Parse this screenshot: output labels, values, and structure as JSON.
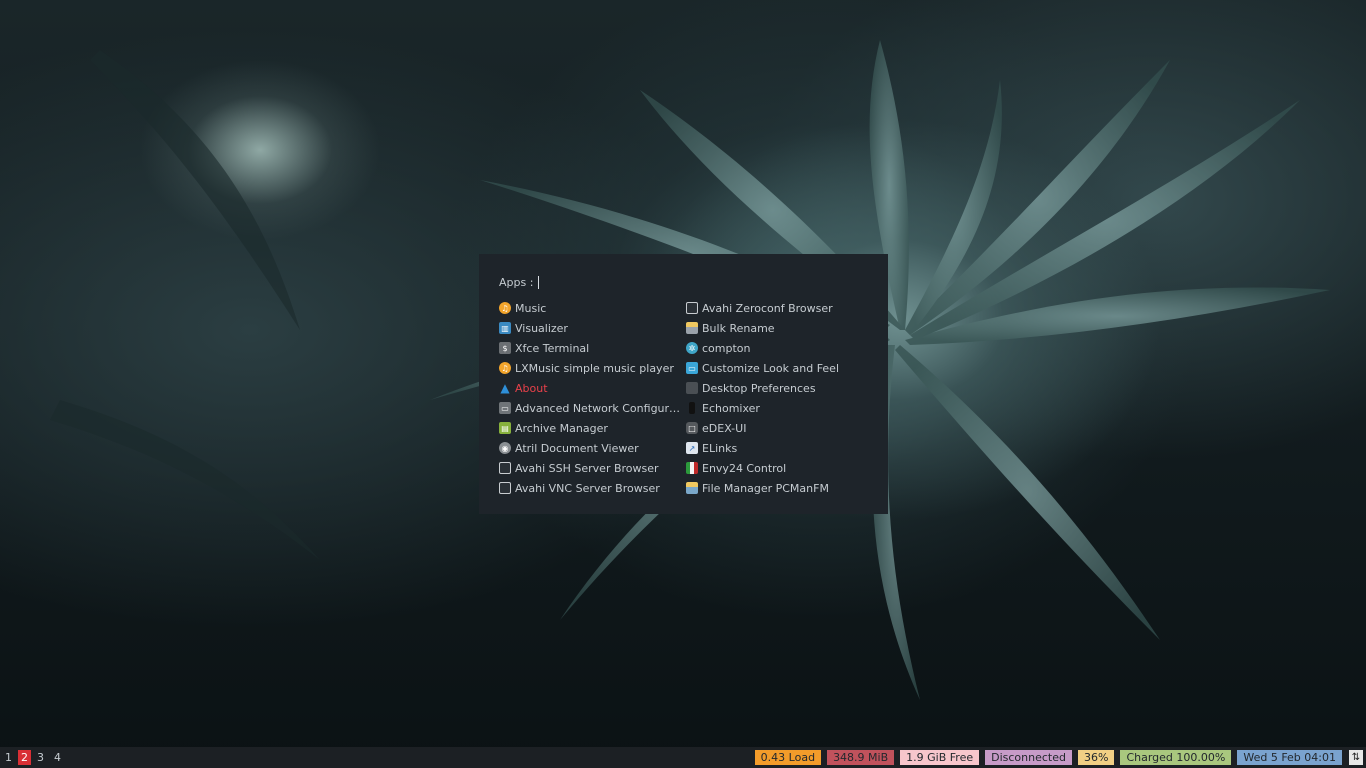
{
  "launcher": {
    "prompt": "Apps :",
    "left_items": [
      {
        "label": "Music",
        "icon": "music-icon"
      },
      {
        "label": "Visualizer",
        "icon": "visualizer-icon"
      },
      {
        "label": "Xfce Terminal",
        "icon": "terminal-icon"
      },
      {
        "label": "LXMusic simple music player",
        "icon": "music-icon"
      },
      {
        "label": "About",
        "icon": "about-icon",
        "selected": true
      },
      {
        "label": "Advanced Network Configurati...",
        "icon": "network-icon"
      },
      {
        "label": "Archive Manager",
        "icon": "archive-icon"
      },
      {
        "label": "Atril Document Viewer",
        "icon": "eye-icon"
      },
      {
        "label": "Avahi SSH Server Browser",
        "icon": "monitor-icon"
      },
      {
        "label": "Avahi VNC Server Browser",
        "icon": "monitor-icon"
      }
    ],
    "right_items": [
      {
        "label": "Avahi Zeroconf Browser",
        "icon": "monitor-icon"
      },
      {
        "label": "Bulk Rename",
        "icon": "rename-icon"
      },
      {
        "label": "compton",
        "icon": "gear-icon"
      },
      {
        "label": "Customize Look and Feel",
        "icon": "look-icon"
      },
      {
        "label": "Desktop Preferences",
        "icon": "desktop-icon"
      },
      {
        "label": "Echomixer",
        "icon": "mixer-icon"
      },
      {
        "label": "eDEX-UI",
        "icon": "edex-icon"
      },
      {
        "label": "ELinks",
        "icon": "browser-icon"
      },
      {
        "label": "Envy24 Control",
        "icon": "envy-icon"
      },
      {
        "label": "File Manager PCManFM",
        "icon": "file-manager-icon"
      }
    ]
  },
  "panel": {
    "workspaces": [
      "1",
      "2",
      "3",
      "4"
    ],
    "active_workspace": "2",
    "load": "0.43 Load",
    "memory": "348.9 MiB",
    "disk": "1.9 GiB Free",
    "network": "Disconnected",
    "volume": "36%",
    "battery": "Charged 100.00%",
    "clock": "Wed 5 Feb 04:01",
    "colors": {
      "load": "#f39c2a",
      "memory": "#c0525c",
      "disk": "#f7c6cc",
      "network": "#c79bc8",
      "volume": "#f1cf84",
      "battery": "#a9c77e",
      "clock": "#7aa3cf",
      "active_workspace": "#d92f35"
    }
  }
}
